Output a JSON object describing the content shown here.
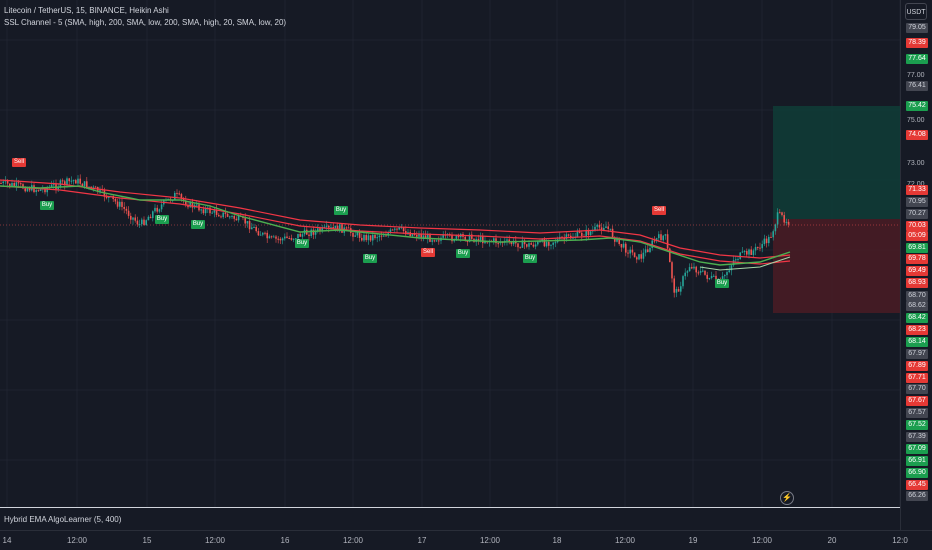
{
  "legend": {
    "main": "Litecoin / TetherUS, 15, BINANCE, Heikin Ashi",
    "ssl": "SSL Channel - 5 (SMA, high, 200, SMA, low, 200, SMA, high, 20, SMA, low, 20)",
    "hybrid": "Hybrid EMA AlgoLearner (5, 400)"
  },
  "currency": "USDT",
  "bolt_icon": "lightning-icon",
  "price_scale": {
    "labels": [
      "77.00",
      "75.00",
      "73.00",
      "72.00"
    ]
  },
  "price_tags": [
    {
      "text": "79.05",
      "bg": "#434651",
      "fg": "#d1d4dc"
    },
    {
      "text": "78.39",
      "bg": "#e53935",
      "fg": "#ffffff"
    },
    {
      "text": "77.64",
      "bg": "#1b9e4f",
      "fg": "#ffffff"
    },
    {
      "text": "76.41",
      "bg": "#434651",
      "fg": "#d1d4dc"
    },
    {
      "text": "75.42",
      "bg": "#1b9e4f",
      "fg": "#ffffff"
    },
    {
      "text": "74.08",
      "bg": "#e53935",
      "fg": "#ffffff"
    },
    {
      "text": "71.33",
      "bg": "#e53935",
      "fg": "#ffffff"
    },
    {
      "text": "70.95",
      "bg": "#434651",
      "fg": "#d1d4dc"
    },
    {
      "text": "70.27",
      "bg": "#434651",
      "fg": "#d1d4dc"
    },
    {
      "text": "70.03",
      "bg": "#e53935",
      "fg": "#ffffff"
    },
    {
      "text": "05:09",
      "bg": "#e53935",
      "fg": "#ffffff"
    },
    {
      "text": "69.81",
      "bg": "#1b9e4f",
      "fg": "#ffffff"
    },
    {
      "text": "69.78",
      "bg": "#e53935",
      "fg": "#ffffff"
    },
    {
      "text": "69.49",
      "bg": "#e53935",
      "fg": "#ffffff"
    },
    {
      "text": "68.93",
      "bg": "#e53935",
      "fg": "#ffffff"
    },
    {
      "text": "68.70",
      "bg": "#434651",
      "fg": "#d1d4dc"
    },
    {
      "text": "68.62",
      "bg": "#434651",
      "fg": "#d1d4dc"
    },
    {
      "text": "68.42",
      "bg": "#1b9e4f",
      "fg": "#ffffff"
    },
    {
      "text": "68.23",
      "bg": "#e53935",
      "fg": "#ffffff"
    },
    {
      "text": "68.14",
      "bg": "#1b9e4f",
      "fg": "#ffffff"
    },
    {
      "text": "67.97",
      "bg": "#434651",
      "fg": "#d1d4dc"
    },
    {
      "text": "67.89",
      "bg": "#e53935",
      "fg": "#ffffff"
    },
    {
      "text": "67.71",
      "bg": "#e53935",
      "fg": "#ffffff"
    },
    {
      "text": "67.70",
      "bg": "#434651",
      "fg": "#d1d4dc"
    },
    {
      "text": "67.67",
      "bg": "#e53935",
      "fg": "#ffffff"
    },
    {
      "text": "67.57",
      "bg": "#434651",
      "fg": "#d1d4dc"
    },
    {
      "text": "67.52",
      "bg": "#1b9e4f",
      "fg": "#ffffff"
    },
    {
      "text": "67.39",
      "bg": "#434651",
      "fg": "#d1d4dc"
    },
    {
      "text": "67.09",
      "bg": "#1b9e4f",
      "fg": "#ffffff"
    },
    {
      "text": "66.91",
      "bg": "#1b9e4f",
      "fg": "#ffffff"
    },
    {
      "text": "66.90",
      "bg": "#1b9e4f",
      "fg": "#ffffff"
    },
    {
      "text": "66.45",
      "bg": "#e53935",
      "fg": "#ffffff"
    },
    {
      "text": "66.26",
      "bg": "#434651",
      "fg": "#d1d4dc"
    }
  ],
  "time_axis": [
    "14",
    "12:00",
    "15",
    "12:00",
    "16",
    "12:00",
    "17",
    "12:00",
    "18",
    "12:00",
    "19",
    "12:00",
    "20",
    "12:0"
  ],
  "signals": [
    {
      "label": "Sell",
      "kind": "sell"
    },
    {
      "label": "Buy",
      "kind": "buy"
    },
    {
      "label": "Buy",
      "kind": "buy"
    },
    {
      "label": "Buy",
      "kind": "buy"
    },
    {
      "label": "Buy",
      "kind": "buy"
    },
    {
      "label": "Sell",
      "kind": "sell"
    },
    {
      "label": "Buy",
      "kind": "buy"
    },
    {
      "label": "Buy",
      "kind": "buy"
    },
    {
      "label": "Buy",
      "kind": "buy"
    },
    {
      "label": "Buy",
      "kind": "buy"
    },
    {
      "label": "Sell",
      "kind": "sell"
    },
    {
      "label": "Buy",
      "kind": "buy"
    }
  ],
  "colors": {
    "background": "#161a25",
    "up": "#26a69a",
    "down": "#ef5350",
    "ssl_red": "#f23645",
    "ssl_green": "#4caf50",
    "take_profit_zone": "#0f3d37",
    "stop_loss_zone": "#4a1c24"
  }
}
